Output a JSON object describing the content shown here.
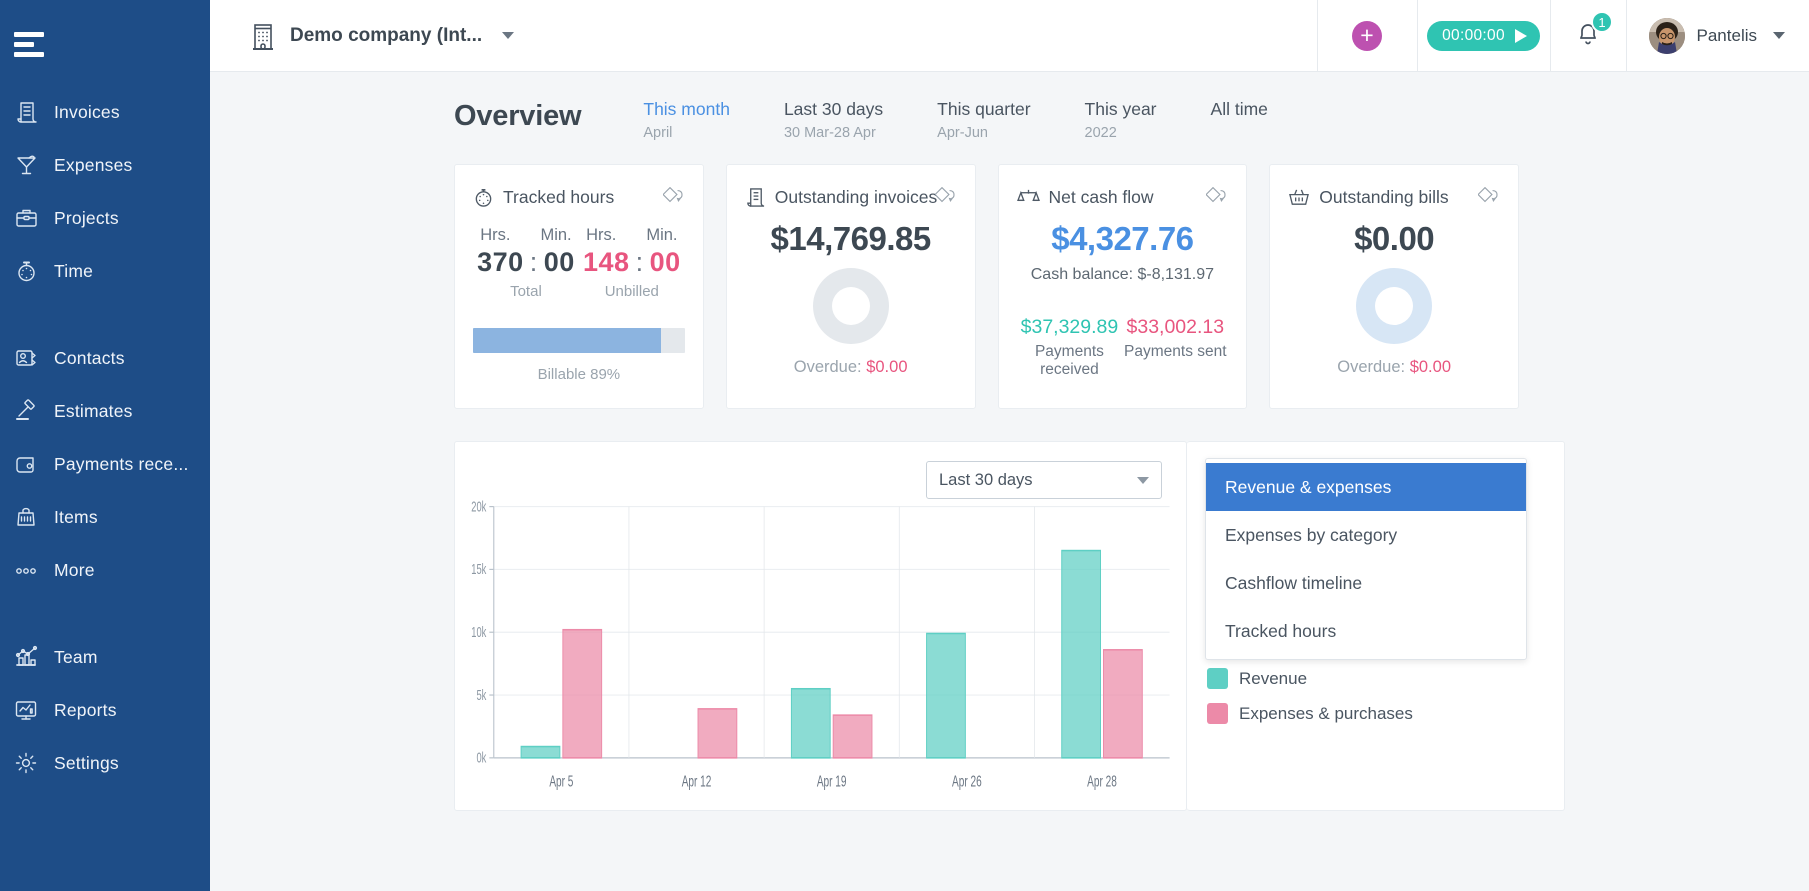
{
  "sidebar": {
    "groups": [
      {
        "items": [
          {
            "label": "Invoices",
            "icon": "invoice-icon",
            "name": "invoices"
          },
          {
            "label": "Expenses",
            "icon": "cocktail-icon",
            "name": "expenses"
          },
          {
            "label": "Projects",
            "icon": "briefcase-icon",
            "name": "projects"
          },
          {
            "label": "Time",
            "icon": "stopwatch-icon",
            "name": "time"
          }
        ]
      },
      {
        "items": [
          {
            "label": "Contacts",
            "icon": "contacts-icon",
            "name": "contacts"
          },
          {
            "label": "Estimates",
            "icon": "gavel-icon",
            "name": "estimates"
          },
          {
            "label": "Payments rece...",
            "icon": "wallet-icon",
            "name": "payments-received"
          },
          {
            "label": "Items",
            "icon": "items-icon",
            "name": "items"
          },
          {
            "label": "More",
            "icon": "ellipsis-icon",
            "name": "more"
          }
        ]
      },
      {
        "items": [
          {
            "label": "Team",
            "icon": "team-chart-icon",
            "name": "team"
          },
          {
            "label": "Reports",
            "icon": "reports-icon",
            "name": "reports"
          },
          {
            "label": "Settings",
            "icon": "gear-icon",
            "name": "settings"
          }
        ]
      }
    ]
  },
  "topbar": {
    "company": "Demo company (Int...",
    "timer": "00:00:00",
    "notifications": "1",
    "user": "Pantelis"
  },
  "overview": {
    "title": "Overview",
    "ranges": [
      {
        "main": "This month",
        "sub": "April",
        "active": true
      },
      {
        "main": "Last 30 days",
        "sub": "30 Mar-28 Apr",
        "active": false
      },
      {
        "main": "This quarter",
        "sub": "Apr-Jun",
        "active": false
      },
      {
        "main": "This year",
        "sub": "2022",
        "active": false
      },
      {
        "main": "All time",
        "sub": "",
        "active": false
      }
    ]
  },
  "cards": {
    "tracked_hours": {
      "title": "Tracked hours",
      "total": {
        "hrs_label": "Hrs.",
        "min_label": "Min.",
        "hrs": "370",
        "min": "00",
        "caption": "Total"
      },
      "unbilled": {
        "hrs_label": "Hrs.",
        "min_label": "Min.",
        "hrs": "148",
        "min": "00",
        "caption": "Unbilled"
      },
      "billable_percent": 89,
      "billable_caption": "Billable 89%"
    },
    "outstanding_invoices": {
      "title": "Outstanding invoices",
      "amount": "$14,769.85",
      "overdue_label": "Overdue:",
      "overdue_amount": "$0.00"
    },
    "net_cash_flow": {
      "title": "Net cash flow",
      "amount": "$4,327.76",
      "cash_balance": "Cash balance: $-8,131.97",
      "payments_received": "$37,329.89",
      "payments_received_label": "Payments received",
      "payments_sent": "$33,002.13",
      "payments_sent_label": "Payments sent"
    },
    "outstanding_bills": {
      "title": "Outstanding bills",
      "amount": "$0.00",
      "overdue_label": "Overdue:",
      "overdue_amount": "$0.00"
    }
  },
  "chart_panel": {
    "range_select": "Last 30 days",
    "menu": [
      {
        "label": "Revenue & expenses",
        "selected": true
      },
      {
        "label": "Expenses by category",
        "selected": false
      },
      {
        "label": "Cashflow timeline",
        "selected": false
      },
      {
        "label": "Tracked hours",
        "selected": false
      }
    ]
  },
  "colors": {
    "sidebar": "#1e4d87",
    "revenue": "#5ecfc4",
    "expenses": "#ec8aa8",
    "accent_blue": "#4a90e2",
    "accent_pink": "#e8557f",
    "accent_teal": "#2fc4b2",
    "accent_purple": "#bd51b0",
    "menu_selected": "#3a7bd0"
  },
  "chart_data": {
    "type": "bar",
    "title": "",
    "xlabel": "",
    "ylabel": "",
    "categories": [
      "Apr 5",
      "Apr 12",
      "Apr 19",
      "Apr 26",
      "Apr 28"
    ],
    "series": [
      {
        "name": "Revenue",
        "color": "#5ecfc4",
        "values": [
          900,
          0,
          5500,
          9900,
          16500
        ]
      },
      {
        "name": "Expenses & purchases",
        "color": "#ec8aa8",
        "values": [
          10200,
          3900,
          3400,
          0,
          8600
        ]
      }
    ],
    "ylim": [
      0,
      20000
    ],
    "yticks": [
      0,
      5000,
      10000,
      15000,
      20000
    ],
    "ytick_labels": [
      "0k",
      "5k",
      "10k",
      "15k",
      "20k"
    ],
    "grid": true,
    "legend_position": "right",
    "legend": [
      {
        "label": "Revenue",
        "color": "#5ecfc4"
      },
      {
        "label": "Expenses & purchases",
        "color": "#ec8aa8"
      }
    ]
  }
}
